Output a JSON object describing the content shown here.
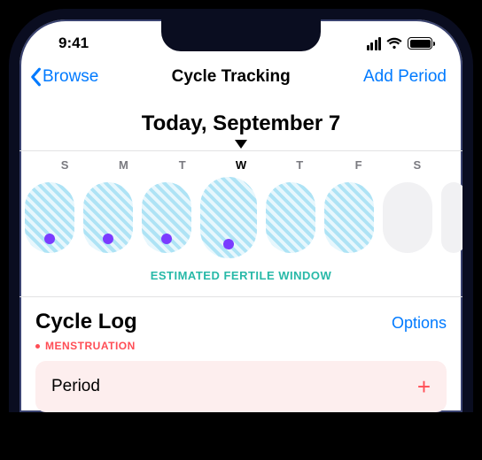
{
  "statusbar": {
    "time": "9:41"
  },
  "nav": {
    "back": "Browse",
    "title": "Cycle Tracking",
    "action": "Add Period"
  },
  "date_heading": "Today, September 7",
  "week": {
    "letters": [
      "S",
      "M",
      "T",
      "W",
      "T",
      "F",
      "S"
    ],
    "currentIndex": 3,
    "days": [
      {
        "fertile": true,
        "dot": true
      },
      {
        "fertile": true,
        "dot": true
      },
      {
        "fertile": true,
        "dot": true
      },
      {
        "fertile": true,
        "dot": true
      },
      {
        "fertile": true,
        "dot": false
      },
      {
        "fertile": true,
        "dot": false
      },
      {
        "fertile": false,
        "dot": false
      }
    ],
    "caption": "ESTIMATED FERTILE WINDOW"
  },
  "log": {
    "title": "Cycle Log",
    "options_label": "Options",
    "section_label": "MENSTRUATION",
    "row_label": "Period"
  }
}
